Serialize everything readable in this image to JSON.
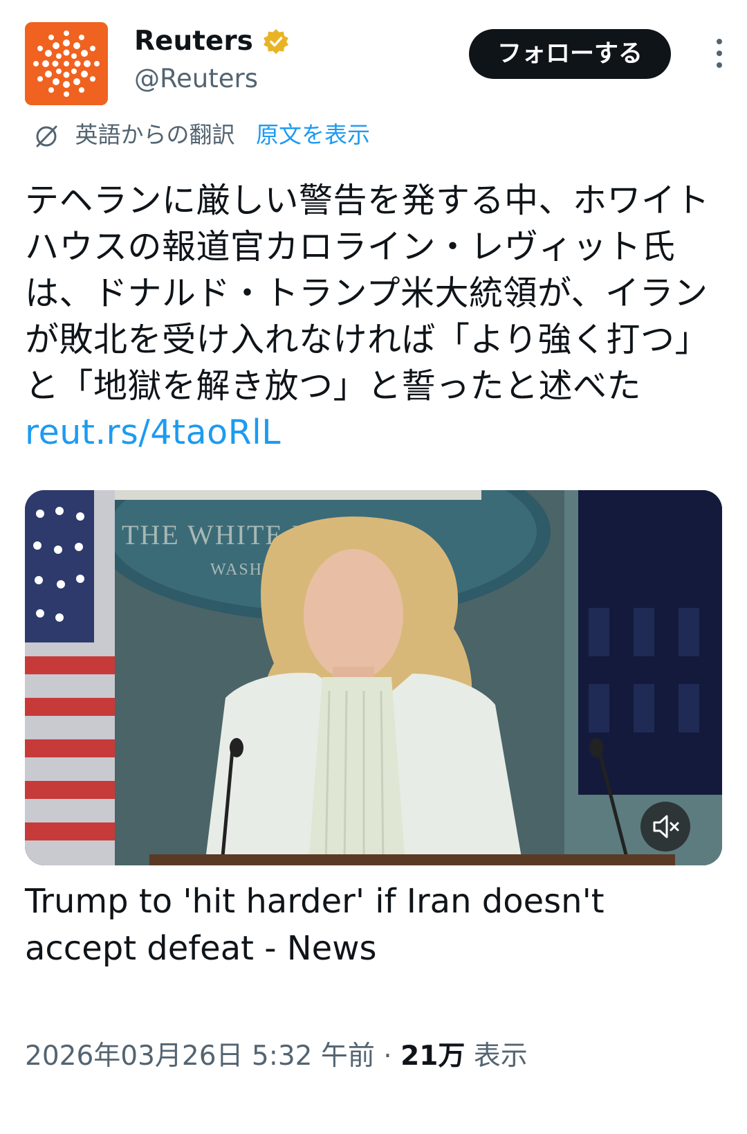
{
  "account": {
    "display_name": "Reuters",
    "handle": "@Reuters",
    "verified_icon": "gold-verified-badge",
    "brand_color": "#f0621f"
  },
  "follow_label": "フォローする",
  "translation": {
    "label": "英語からの翻訳",
    "show_original": "原文を表示"
  },
  "tweet": {
    "text": "テヘランに厳しい警告を発する中、ホワイトハウスの報道官カロライン・レヴィット氏は、ドナルド・トランプ米大統領が、イランが敗北を受け入れなければ「より強く打つ」と「地獄を解き放つ」と誓ったと述べた",
    "link": "reut.rs/4taoRlL"
  },
  "media": {
    "backdrop_text_1": "THE WHITE HOUSE",
    "backdrop_text_2": "WASHINGTON",
    "mute_icon": "volume-muted-icon"
  },
  "card_title": "Trump to 'hit harder' if Iran doesn't accept defeat - News",
  "meta": {
    "datetime": "2026年03月26日 5:32 午前",
    "separator": "·",
    "views": "21万",
    "views_label": "表示"
  }
}
